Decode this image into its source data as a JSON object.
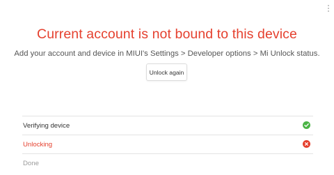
{
  "colors": {
    "error": "#e5402e",
    "success": "#4bb445",
    "muted": "#9a9a9a"
  },
  "header": {
    "title": "Current account is not bound to this device",
    "subtitle": "Add your account and device in MIUI's Settings > Developer options > Mi Unlock status."
  },
  "actions": {
    "unlock_again": "Unlock again"
  },
  "steps": [
    {
      "label": "Verifying device",
      "status": "success",
      "icon": "check-circle-icon"
    },
    {
      "label": "Unlocking",
      "status": "error",
      "icon": "x-circle-icon"
    },
    {
      "label": "Done",
      "status": "pending",
      "icon": ""
    }
  ]
}
